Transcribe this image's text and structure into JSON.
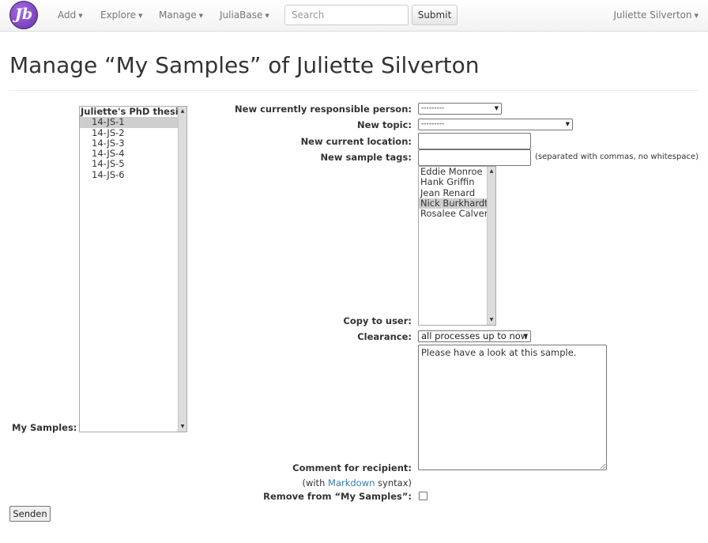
{
  "navbar": {
    "logo_text": "Jb",
    "menus": [
      {
        "label": "Add"
      },
      {
        "label": "Explore"
      },
      {
        "label": "Manage"
      },
      {
        "label": "JuliaBase"
      }
    ],
    "search_placeholder": "Search",
    "submit_label": "Submit",
    "user_name": "Juliette Silverton"
  },
  "page_title": "Manage “My Samples” of Juliette Silverton",
  "my_samples": {
    "label": "My Samples:",
    "group": "Juliette's PhD thesis",
    "items": [
      "14-JS-1",
      "14-JS-2",
      "14-JS-3",
      "14-JS-4",
      "14-JS-5",
      "14-JS-6"
    ],
    "selected_index": 0
  },
  "form": {
    "responsible_label": "New currently responsible person:",
    "responsible_value": "---------",
    "topic_label": "New topic:",
    "topic_value": "---------",
    "location_label": "New current location:",
    "location_value": "",
    "tags_label": "New sample tags:",
    "tags_value": "",
    "tags_hint": "(separated with commas, no whitespace)",
    "copy_label": "Copy to user:",
    "users": [
      "Eddie Monroe",
      "Hank Griffin",
      "Jean Renard",
      "Nick Burkhardt",
      "Rosalee Calvert"
    ],
    "users_selected_index": 3,
    "clearance_label": "Clearance:",
    "clearance_value": "all processes up to now",
    "comment_label": "Comment for recipient:",
    "comment_value": "Please have a look at this sample.",
    "markdown_prefix": "(with ",
    "markdown_link": "Markdown",
    "markdown_suffix": " syntax)",
    "remove_label": "Remove from “My Samples”:",
    "remove_checked": false
  },
  "send_label": "Senden",
  "icons": {
    "dropdown": "caret-down-icon",
    "select": "chevron-down-icon",
    "scroll_up": "arrow-up-icon",
    "scroll_down": "arrow-down-icon"
  }
}
